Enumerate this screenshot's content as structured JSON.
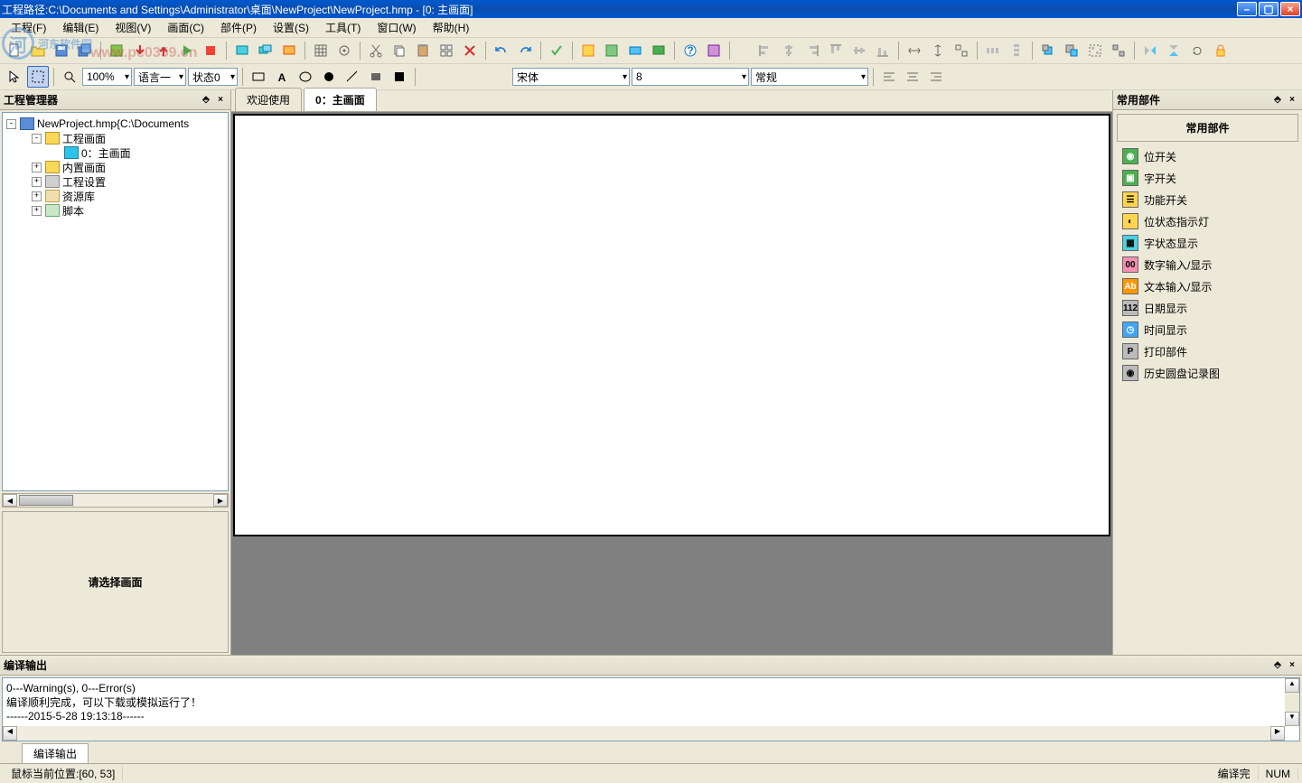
{
  "titlebar": {
    "path": "工程路径:C:\\Documents and Settings\\Administrator\\桌面\\NewProject\\NewProject.hmp    -  [0: 主画面]"
  },
  "menu": {
    "items": [
      "工程(F)",
      "编辑(E)",
      "视图(V)",
      "画面(C)",
      "部件(P)",
      "设置(S)",
      "工具(T)",
      "窗口(W)",
      "帮助(H)"
    ]
  },
  "toolbar2": {
    "zoom": "100%",
    "lang": "语言一",
    "state": "状态0"
  },
  "toolbar3": {
    "font": "宋体",
    "size": "8",
    "weight": "常规"
  },
  "tree": {
    "title": "工程管理器",
    "root": "NewProject.hmp{C:\\Documents",
    "items": [
      {
        "label": "工程画面",
        "icon": "folder",
        "indent": 1,
        "expand": "-"
      },
      {
        "label": "0：主画面",
        "icon": "screen",
        "indent": 2,
        "expand": ""
      },
      {
        "label": "内置画面",
        "icon": "folder",
        "indent": 1,
        "expand": "+"
      },
      {
        "label": "工程设置",
        "icon": "gear",
        "indent": 1,
        "expand": "+"
      },
      {
        "label": "资源库",
        "icon": "lib",
        "indent": 1,
        "expand": "+"
      },
      {
        "label": "脚本",
        "icon": "script",
        "indent": 1,
        "expand": "+"
      }
    ],
    "preview": "请选择画面"
  },
  "tabs": {
    "welcome": "欢迎使用",
    "main": "0：主画面"
  },
  "right": {
    "title": "常用部件",
    "header": "常用部件",
    "items": [
      {
        "label": "位开关",
        "cls": "pi-green",
        "ic": "◉"
      },
      {
        "label": "字开关",
        "cls": "pi-green",
        "ic": "▣"
      },
      {
        "label": "功能开关",
        "cls": "pi-yellow",
        "ic": "☰"
      },
      {
        "label": "位状态指示灯",
        "cls": "pi-yellow",
        "ic": "◐"
      },
      {
        "label": "字状态显示",
        "cls": "pi-cyan",
        "ic": "▦"
      },
      {
        "label": "数字输入/显示",
        "cls": "pi-pink",
        "ic": "00"
      },
      {
        "label": "文本输入/显示",
        "cls": "pi-orange",
        "ic": "Ab"
      },
      {
        "label": "日期显示",
        "cls": "pi-gray",
        "ic": "112"
      },
      {
        "label": "时间显示",
        "cls": "pi-blue",
        "ic": "◷"
      },
      {
        "label": "打印部件",
        "cls": "pi-gray",
        "ic": "P"
      },
      {
        "label": "历史圆盘记录图",
        "cls": "pi-gray",
        "ic": "◉"
      }
    ]
  },
  "output": {
    "title": "编译输出",
    "line1": "    0---Warning(s), 0---Error(s)",
    "line2": "编译顺利完成，可以下载或模拟运行了！",
    "line3": "------2015-5-28 19:13:18------",
    "tab": "编译输出"
  },
  "status": {
    "mouse": "鼠标当前位置:[60, 53]",
    "compile": "编译完",
    "num": "NUM"
  },
  "watermark": {
    "t1": "河东软件园",
    "t2": "www.pc0359.cn"
  }
}
